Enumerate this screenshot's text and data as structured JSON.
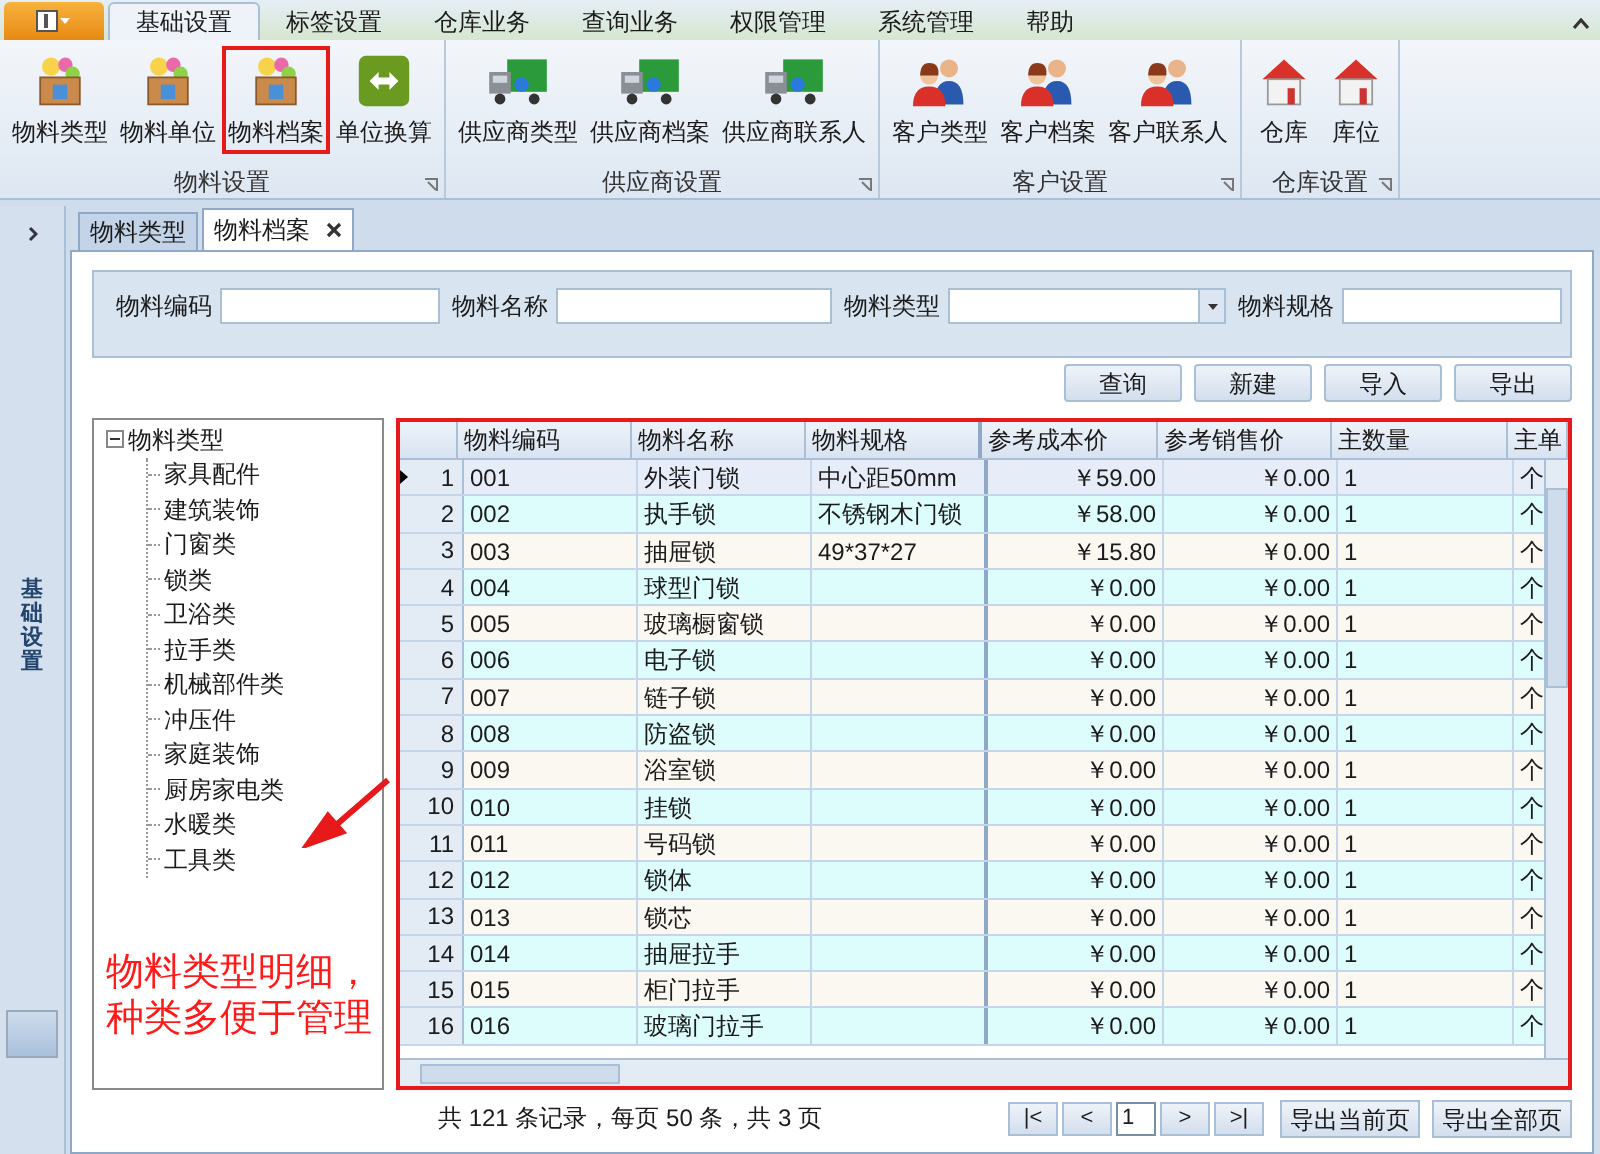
{
  "menu_tabs": [
    {
      "label": "基础设置",
      "selected": true
    },
    {
      "label": "标签设置",
      "selected": false
    },
    {
      "label": "仓库业务",
      "selected": false
    },
    {
      "label": "查询业务",
      "selected": false
    },
    {
      "label": "权限管理",
      "selected": false
    },
    {
      "label": "系统管理",
      "selected": false
    },
    {
      "label": "帮助",
      "selected": false
    }
  ],
  "ribbon_groups": [
    {
      "title": "物料设置",
      "items": [
        {
          "label": "物料类型",
          "kind": "box",
          "highlighted": false
        },
        {
          "label": "物料单位",
          "kind": "box",
          "highlighted": false
        },
        {
          "label": "物料档案",
          "kind": "box",
          "highlighted": true
        },
        {
          "label": "单位换算",
          "kind": "arrows",
          "highlighted": false
        }
      ]
    },
    {
      "title": "供应商设置",
      "items": [
        {
          "label": "供应商类型",
          "kind": "truck",
          "highlighted": false
        },
        {
          "label": "供应商档案",
          "kind": "truck",
          "highlighted": false
        },
        {
          "label": "供应商联系人",
          "kind": "truck",
          "highlighted": false
        }
      ]
    },
    {
      "title": "客户设置",
      "items": [
        {
          "label": "客户类型",
          "kind": "people",
          "highlighted": false
        },
        {
          "label": "客户档案",
          "kind": "people",
          "highlighted": false
        },
        {
          "label": "客户联系人",
          "kind": "people",
          "highlighted": false
        }
      ]
    },
    {
      "title": "仓库设置",
      "items": [
        {
          "label": "仓库",
          "kind": "house",
          "highlighted": false
        },
        {
          "label": "库位",
          "kind": "house",
          "highlighted": false
        }
      ]
    }
  ],
  "sidebar": {
    "title": "基础设置"
  },
  "doc_tabs": [
    {
      "label": "物料类型",
      "selected": false,
      "closable": false
    },
    {
      "label": "物料档案",
      "selected": true,
      "closable": true
    }
  ],
  "filters": [
    {
      "label": "物料编码",
      "kind": "text"
    },
    {
      "label": "物料名称",
      "kind": "text"
    },
    {
      "label": "物料类型",
      "kind": "dropdown"
    },
    {
      "label": "物料规格",
      "kind": "text"
    }
  ],
  "actions": [
    "查询",
    "新建",
    "导入",
    "导出"
  ],
  "tree": {
    "label": "物料类型",
    "expanded": true,
    "children": [
      {
        "label": "家具配件"
      },
      {
        "label": "建筑装饰"
      },
      {
        "label": "门窗类"
      },
      {
        "label": "锁类"
      },
      {
        "label": "卫浴类"
      },
      {
        "label": "拉手类"
      },
      {
        "label": "机械部件类"
      },
      {
        "label": "冲压件"
      },
      {
        "label": "家庭装饰"
      },
      {
        "label": "厨房家电类"
      },
      {
        "label": "水暖类"
      },
      {
        "label": "工具类"
      }
    ]
  },
  "table": {
    "columns": [
      "物料编码",
      "物料名称",
      "物料规格",
      "参考成本价",
      "参考销售价",
      "主数量",
      "主单"
    ],
    "rows": [
      {
        "index": "1",
        "selected": true,
        "cells": [
          "001",
          "外装门锁",
          "中心距50mm",
          "￥59.00",
          "￥0.00",
          "1",
          "个"
        ]
      },
      {
        "index": "2",
        "selected": false,
        "cells": [
          "002",
          "执手锁",
          "不锈钢木门锁",
          "￥58.00",
          "￥0.00",
          "1",
          "个"
        ]
      },
      {
        "index": "3",
        "selected": false,
        "cells": [
          "003",
          "抽屉锁",
          "49*37*27",
          "￥15.80",
          "￥0.00",
          "1",
          "个"
        ]
      },
      {
        "index": "4",
        "selected": false,
        "cells": [
          "004",
          "球型门锁",
          "",
          "￥0.00",
          "￥0.00",
          "1",
          "个"
        ]
      },
      {
        "index": "5",
        "selected": false,
        "cells": [
          "005",
          "玻璃橱窗锁",
          "",
          "￥0.00",
          "￥0.00",
          "1",
          "个"
        ]
      },
      {
        "index": "6",
        "selected": false,
        "cells": [
          "006",
          "电子锁",
          "",
          "￥0.00",
          "￥0.00",
          "1",
          "个"
        ]
      },
      {
        "index": "7",
        "selected": false,
        "cells": [
          "007",
          "链子锁",
          "",
          "￥0.00",
          "￥0.00",
          "1",
          "个"
        ]
      },
      {
        "index": "8",
        "selected": false,
        "cells": [
          "008",
          "防盗锁",
          "",
          "￥0.00",
          "￥0.00",
          "1",
          "个"
        ]
      },
      {
        "index": "9",
        "selected": false,
        "cells": [
          "009",
          "浴室锁",
          "",
          "￥0.00",
          "￥0.00",
          "1",
          "个"
        ]
      },
      {
        "index": "10",
        "selected": false,
        "cells": [
          "010",
          "挂锁",
          "",
          "￥0.00",
          "￥0.00",
          "1",
          "个"
        ]
      },
      {
        "index": "11",
        "selected": false,
        "cells": [
          "011",
          "号码锁",
          "",
          "￥0.00",
          "￥0.00",
          "1",
          "个"
        ]
      },
      {
        "index": "12",
        "selected": false,
        "cells": [
          "012",
          "锁体",
          "",
          "￥0.00",
          "￥0.00",
          "1",
          "个"
        ]
      },
      {
        "index": "13",
        "selected": false,
        "cells": [
          "013",
          "锁芯",
          "",
          "￥0.00",
          "￥0.00",
          "1",
          "个"
        ]
      },
      {
        "index": "14",
        "selected": false,
        "cells": [
          "014",
          "抽屉拉手",
          "",
          "￥0.00",
          "￥0.00",
          "1",
          "个"
        ]
      },
      {
        "index": "15",
        "selected": false,
        "cells": [
          "015",
          "柜门拉手",
          "",
          "￥0.00",
          "￥0.00",
          "1",
          "个"
        ]
      },
      {
        "index": "16",
        "selected": false,
        "cells": [
          "016",
          "玻璃门拉手",
          "",
          "￥0.00",
          "￥0.00",
          "1",
          "个"
        ]
      }
    ]
  },
  "pager": {
    "summary": "共 121 条记录，每页 50 条，共 3 页",
    "first": "|<",
    "prev": "<",
    "page": "1",
    "next": ">",
    "last": ">|",
    "export_buttons": [
      "导出当前页",
      "导出全部页"
    ]
  },
  "annotation": {
    "text": "物料类型明细，种类多便于管理"
  }
}
